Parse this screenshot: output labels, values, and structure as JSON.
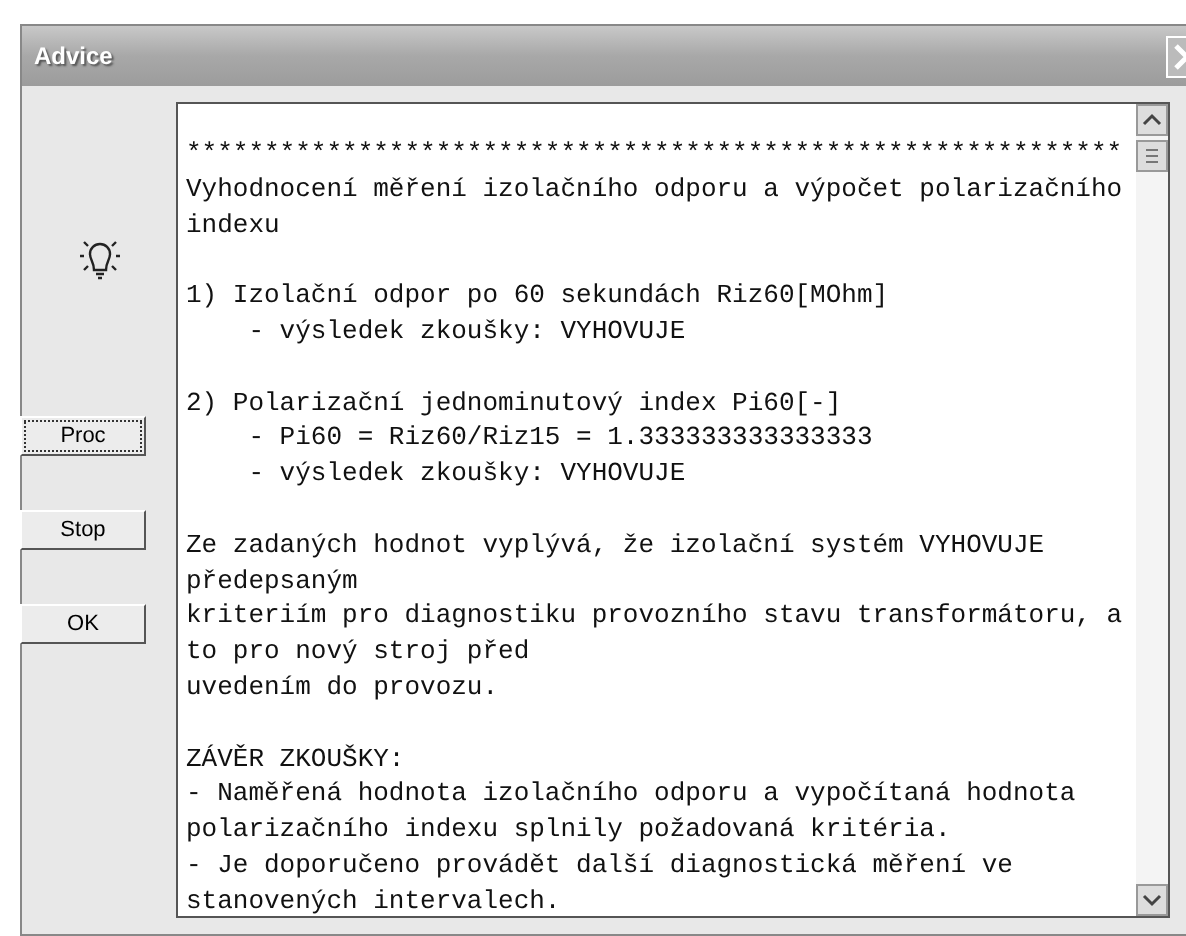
{
  "window": {
    "title": "Advice"
  },
  "buttons": [
    {
      "label": "Proc",
      "focused": true
    },
    {
      "label": "Stop",
      "focused": false
    },
    {
      "label": "OK",
      "focused": false
    }
  ],
  "report": {
    "paragraphs": [
      [
        "************************************************************",
        "Vyhodnocení měření izolačního odporu a výpočet polarizačního",
        "indexu"
      ],
      [
        "1) Izolační odpor po 60 sekundách Riz60[MOhm]",
        "    - výsledek zkoušky: VYHOVUJE"
      ],
      [
        "2) Polarizační jednominutový index Pi60[-]",
        "    - Pi60 = Riz60/Riz15 = 1.333333333333333",
        "    - výsledek zkoušky: VYHOVUJE"
      ],
      [
        "Ze zadaných hodnot vyplývá, že izolační systém VYHOVUJE",
        "předepsaným",
        "kriteriím pro diagnostiku provozního stavu transformátoru, a",
        "to pro nový stroj před",
        "uvedením do provozu."
      ],
      [
        "ZÁVĚR ZKOUŠKY:",
        "- Naměřená hodnota izolačního odporu a vypočítaná hodnota",
        "polarizačního indexu splnily požadovaná kritéria.",
        "- Je doporučeno provádět další diagnostická měření ve",
        "stanovených intervalech."
      ]
    ]
  }
}
